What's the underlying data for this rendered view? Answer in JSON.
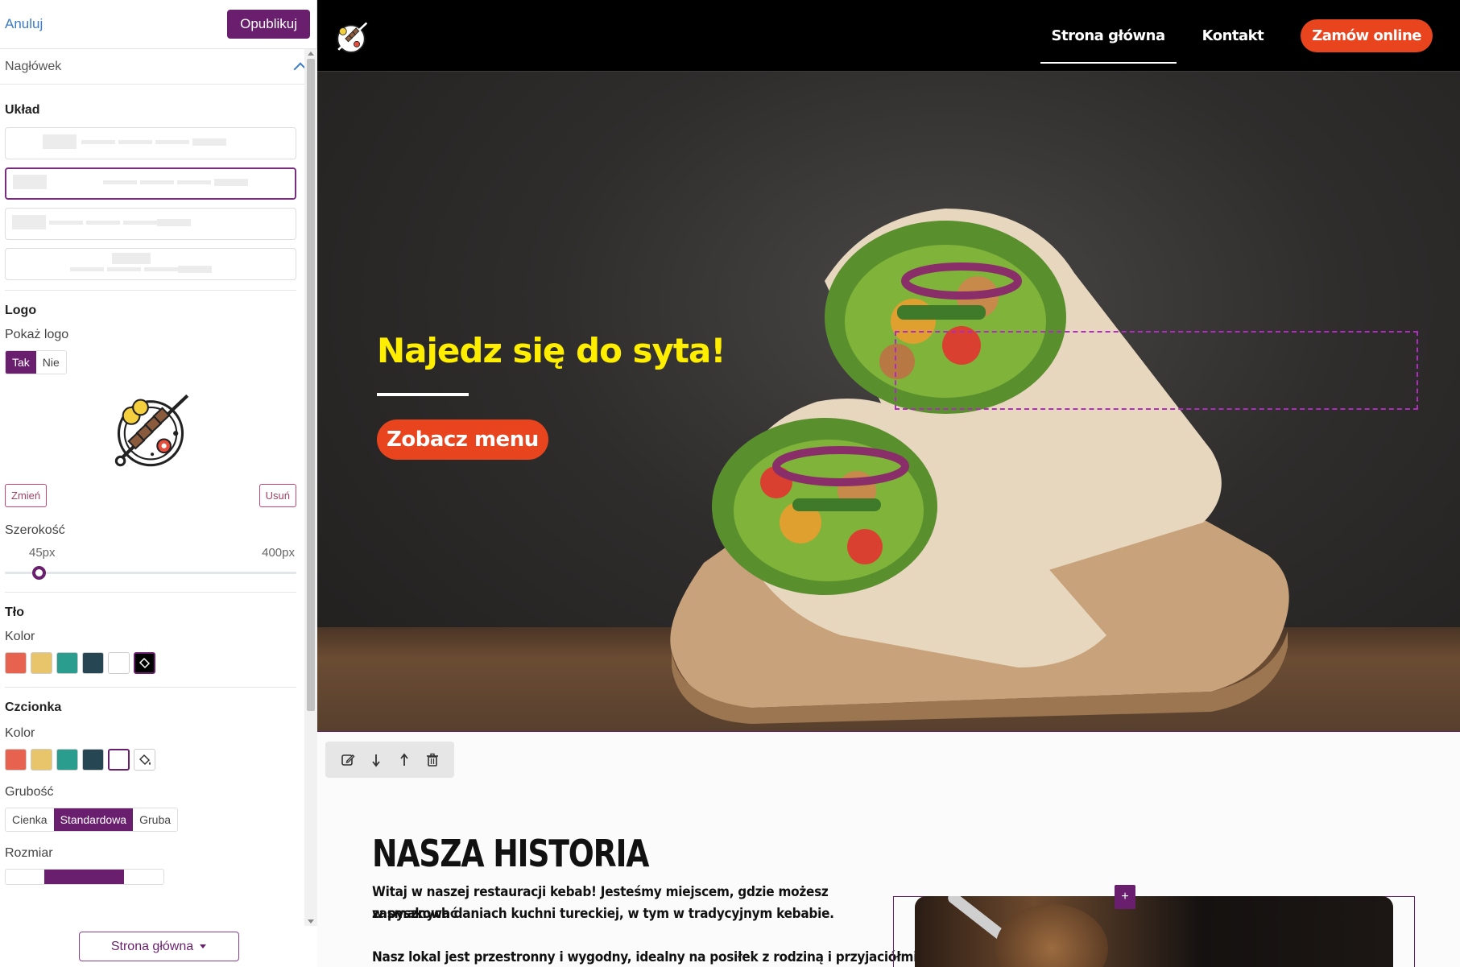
{
  "editor": {
    "cancel_label": "Anuluj",
    "publish_label": "Opublikuj",
    "section_title": "Nagłówek",
    "layout": {
      "title": "Układ"
    },
    "logo": {
      "title": "Logo",
      "show_label": "Pokaż logo",
      "show_options": [
        "Tak",
        "Nie"
      ],
      "show_selected": "Tak",
      "change_label": "Zmień",
      "remove_label": "Usuń",
      "width_label": "Szerokość",
      "width_min": "45px",
      "width_max": "400px",
      "width_value_fraction": 0.0
    },
    "background": {
      "title": "Tło",
      "color_label": "Kolor",
      "swatches": [
        "#e8634f",
        "#e8c46a",
        "#2a9d8f",
        "#264653",
        "#ffffff",
        "#000000"
      ],
      "selected": "#000000"
    },
    "font": {
      "title": "Czcionka",
      "color_label": "Kolor",
      "swatches": [
        "#e8634f",
        "#e8c46a",
        "#2a9d8f",
        "#264653",
        "#ffffff"
      ],
      "selected": "#ffffff",
      "weight_label": "Grubość",
      "weight_options": [
        "Cienka",
        "Standardowa",
        "Gruba"
      ],
      "weight_selected": "Standardowa",
      "size_label": "Rozmiar"
    },
    "page_selector": "Strona główna"
  },
  "site": {
    "nav": {
      "home": "Strona główna",
      "contact": "Kontakt",
      "cta": "Zamów online"
    },
    "hero": {
      "title": "Najedz się do syta!",
      "button": "Zobacz menu"
    },
    "story": {
      "title": "NASZA HISTORIA",
      "p1_line1": "Witaj w naszej restauracji kebab! Jesteśmy miejscem, gdzie możesz zasmakować",
      "p1_line2": "w pysznych daniach kuchni tureckiej, w tym w tradycyjnym kebabie.",
      "p2_line1": "Nasz lokal jest przestronny i wygodny, idealny na posiłek z rodziną i przyjaciółmi."
    },
    "colors": {
      "accent": "#e8441e",
      "brand": "#6a1f6e",
      "hero_title": "#ffee00"
    }
  }
}
